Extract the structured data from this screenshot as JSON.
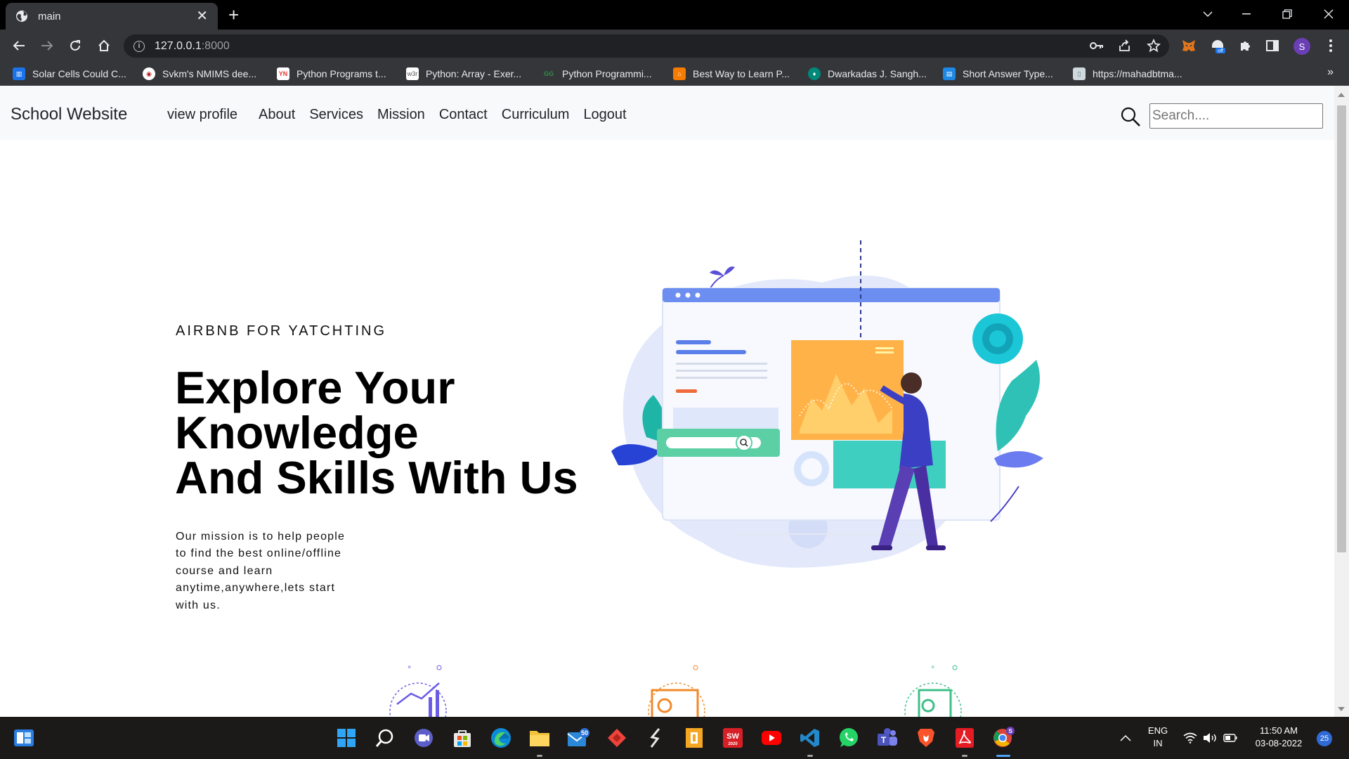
{
  "browser": {
    "tab_title": "main",
    "url_host": "127.0.0.1",
    "url_port": ":8000",
    "profile_initial": "S",
    "bookmarks": [
      {
        "label": "Solar Cells Could C...",
        "icon": "solar-icon",
        "color": "#1a73e8"
      },
      {
        "label": "Svkm's NMIMS dee...",
        "icon": "nmims-icon",
        "color": "#ffffff"
      },
      {
        "label": "Python Programs t...",
        "icon": "python-programs-icon",
        "color": "#e53935"
      },
      {
        "label": "Python: Array - Exer...",
        "icon": "w3r-icon",
        "color": "#ffffff"
      },
      {
        "label": "Python Programmi...",
        "icon": "gfg-icon",
        "color": "#2f8d46"
      },
      {
        "label": "Best Way to Learn P...",
        "icon": "learn-icon",
        "color": "#f57c00"
      },
      {
        "label": "Dwarkadas J. Sangh...",
        "icon": "djs-icon",
        "color": "#00897b"
      },
      {
        "label": "Short Answer Type...",
        "icon": "page-icon",
        "color": "#1e88e5"
      },
      {
        "label": "https://mahadbtma...",
        "icon": "doc-icon",
        "color": "#9e9e9e"
      }
    ],
    "extension_badge": "off"
  },
  "site": {
    "brand": "School Website",
    "nav": [
      "view profile",
      "About",
      "Services",
      "Mission",
      "Contact",
      "Curriculum",
      "Logout"
    ],
    "search_placeholder": "Search....",
    "eyebrow": "AIRBNB FOR YATCHTING",
    "headline": [
      "Explore Your",
      "Knowledge",
      "And Skills With Us"
    ],
    "mission_lines": [
      "Our mission is to help people",
      "to find the best online/offline",
      "course and learn",
      "anytime,anywhere,lets start",
      "with us."
    ]
  },
  "taskbar": {
    "apps": [
      "start-icon",
      "search-icon",
      "meet-icon",
      "store-icon",
      "edge-icon",
      "explorer-icon",
      "mail-icon",
      "anydesk-icon",
      "sublime-icon",
      "ilovepdf-icon",
      "solidworks-icon",
      "youtube-icon",
      "vscode-icon",
      "whatsapp-icon",
      "teams-icon",
      "brave-icon",
      "acrobat-icon",
      "chrome-icon"
    ],
    "mail_badge": "50",
    "solidworks_label": "SW",
    "solidworks_year": "2020",
    "chrome_profile_badge": "S",
    "language": "ENG",
    "region": "IN",
    "time": "11:50 AM",
    "date": "03-08-2022",
    "notification_count": "25"
  }
}
